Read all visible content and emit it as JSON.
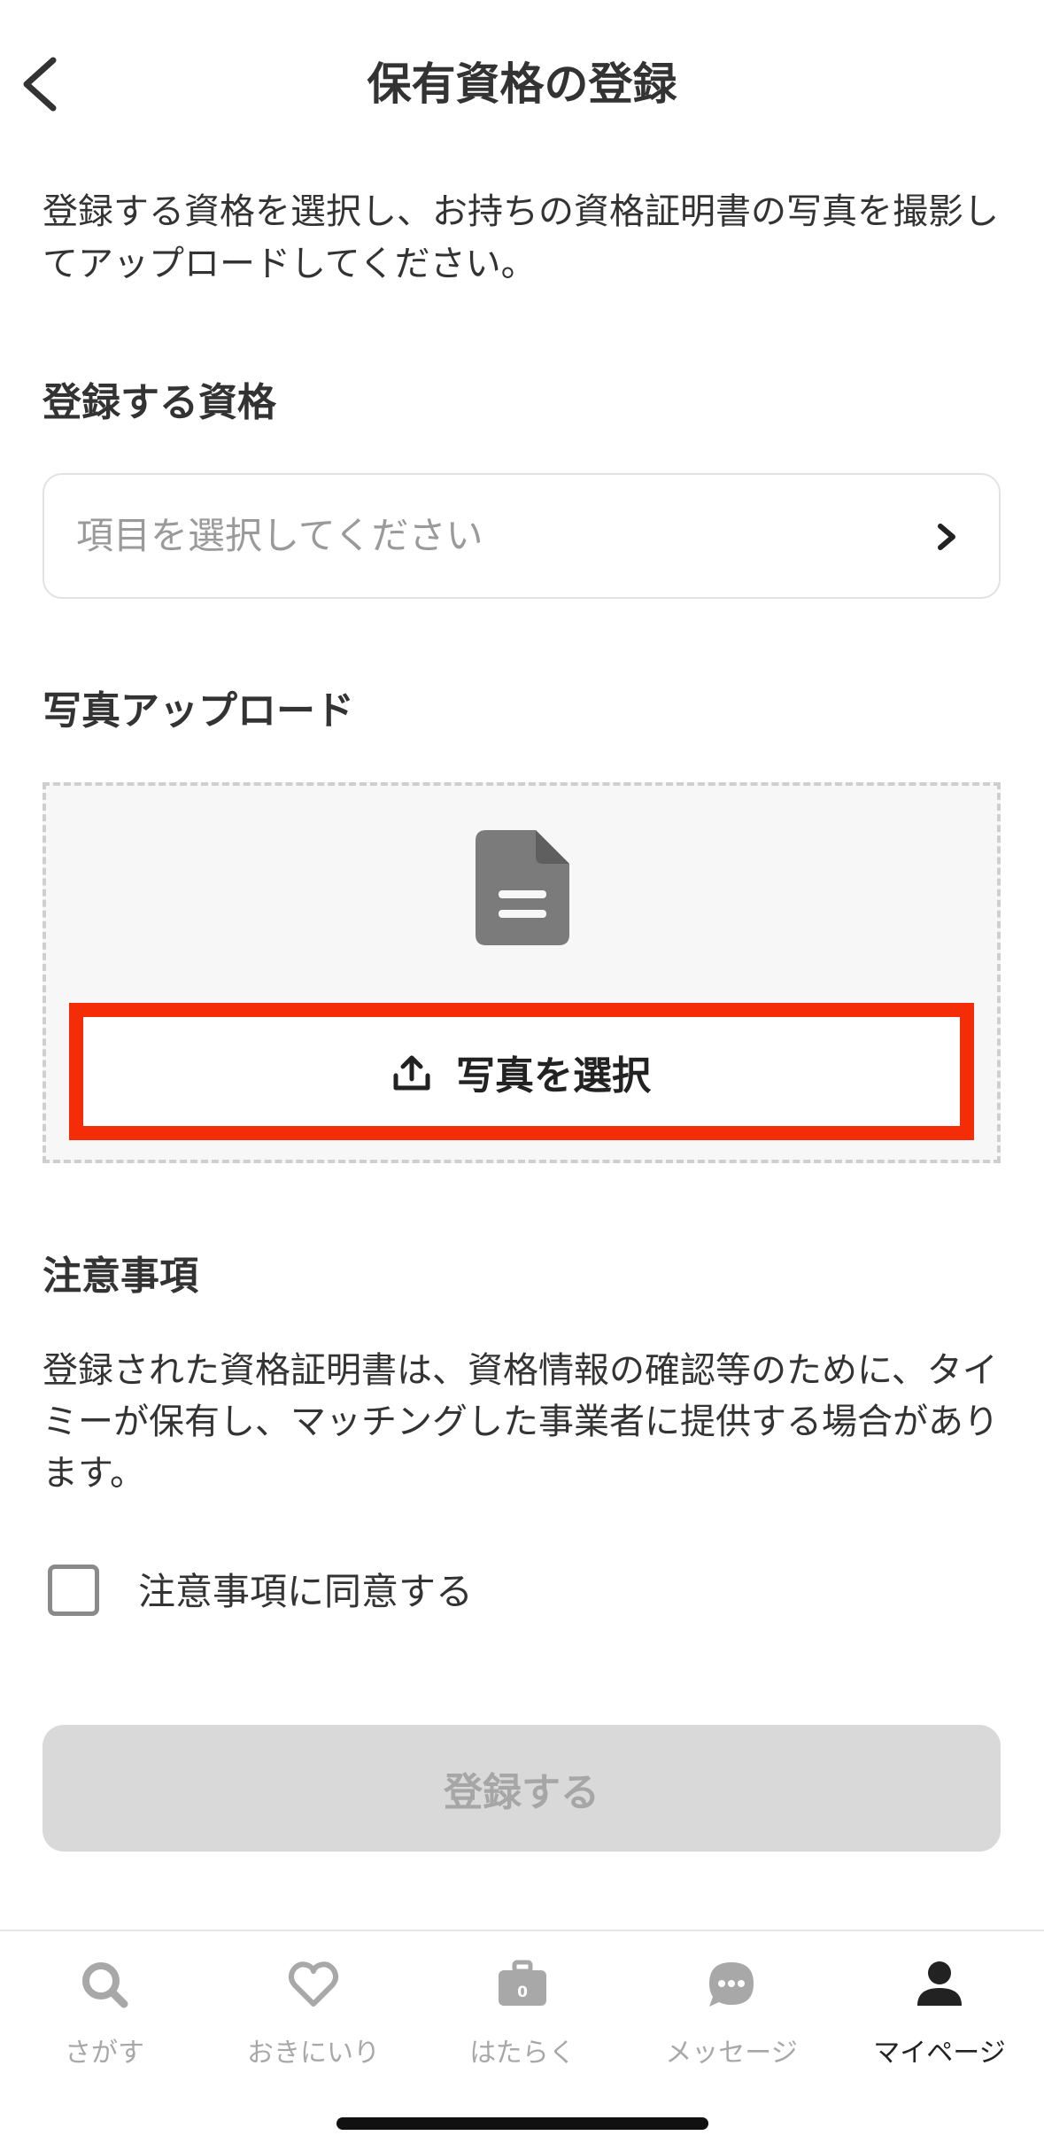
{
  "header": {
    "title": "保有資格の登録",
    "back_icon": "chevron-left-icon"
  },
  "intro_text": "登録する資格を選択し、お持ちの資格証明書の写真を撮影してアップロードしてください。",
  "qualification": {
    "label": "登録する資格",
    "placeholder": "項目を選択してください",
    "icon": "chevron-right-icon"
  },
  "photo_upload": {
    "label": "写真アップロード",
    "document_icon": "document-icon",
    "button_label": "写真を選択",
    "button_icon": "upload-icon",
    "highlight_color": "#f42c08"
  },
  "notice": {
    "heading": "注意事項",
    "body": "登録された資格証明書は、資格情報の確認等のために、タイミーが保有し、マッチングした事業者に提供する場合があります。",
    "agree_label": "注意事項に同意する",
    "agree_checked": false
  },
  "submit": {
    "label": "登録する",
    "enabled": false
  },
  "tabbar": {
    "items": [
      {
        "label": "さがす",
        "icon": "search-icon",
        "active": false
      },
      {
        "label": "おきにいり",
        "icon": "heart-icon",
        "active": false
      },
      {
        "label": "はたらく",
        "icon": "briefcase-icon",
        "active": false,
        "badge": "0"
      },
      {
        "label": "メッセージ",
        "icon": "chat-bubble-icon",
        "active": false
      },
      {
        "label": "マイページ",
        "icon": "person-icon",
        "active": true
      }
    ]
  }
}
